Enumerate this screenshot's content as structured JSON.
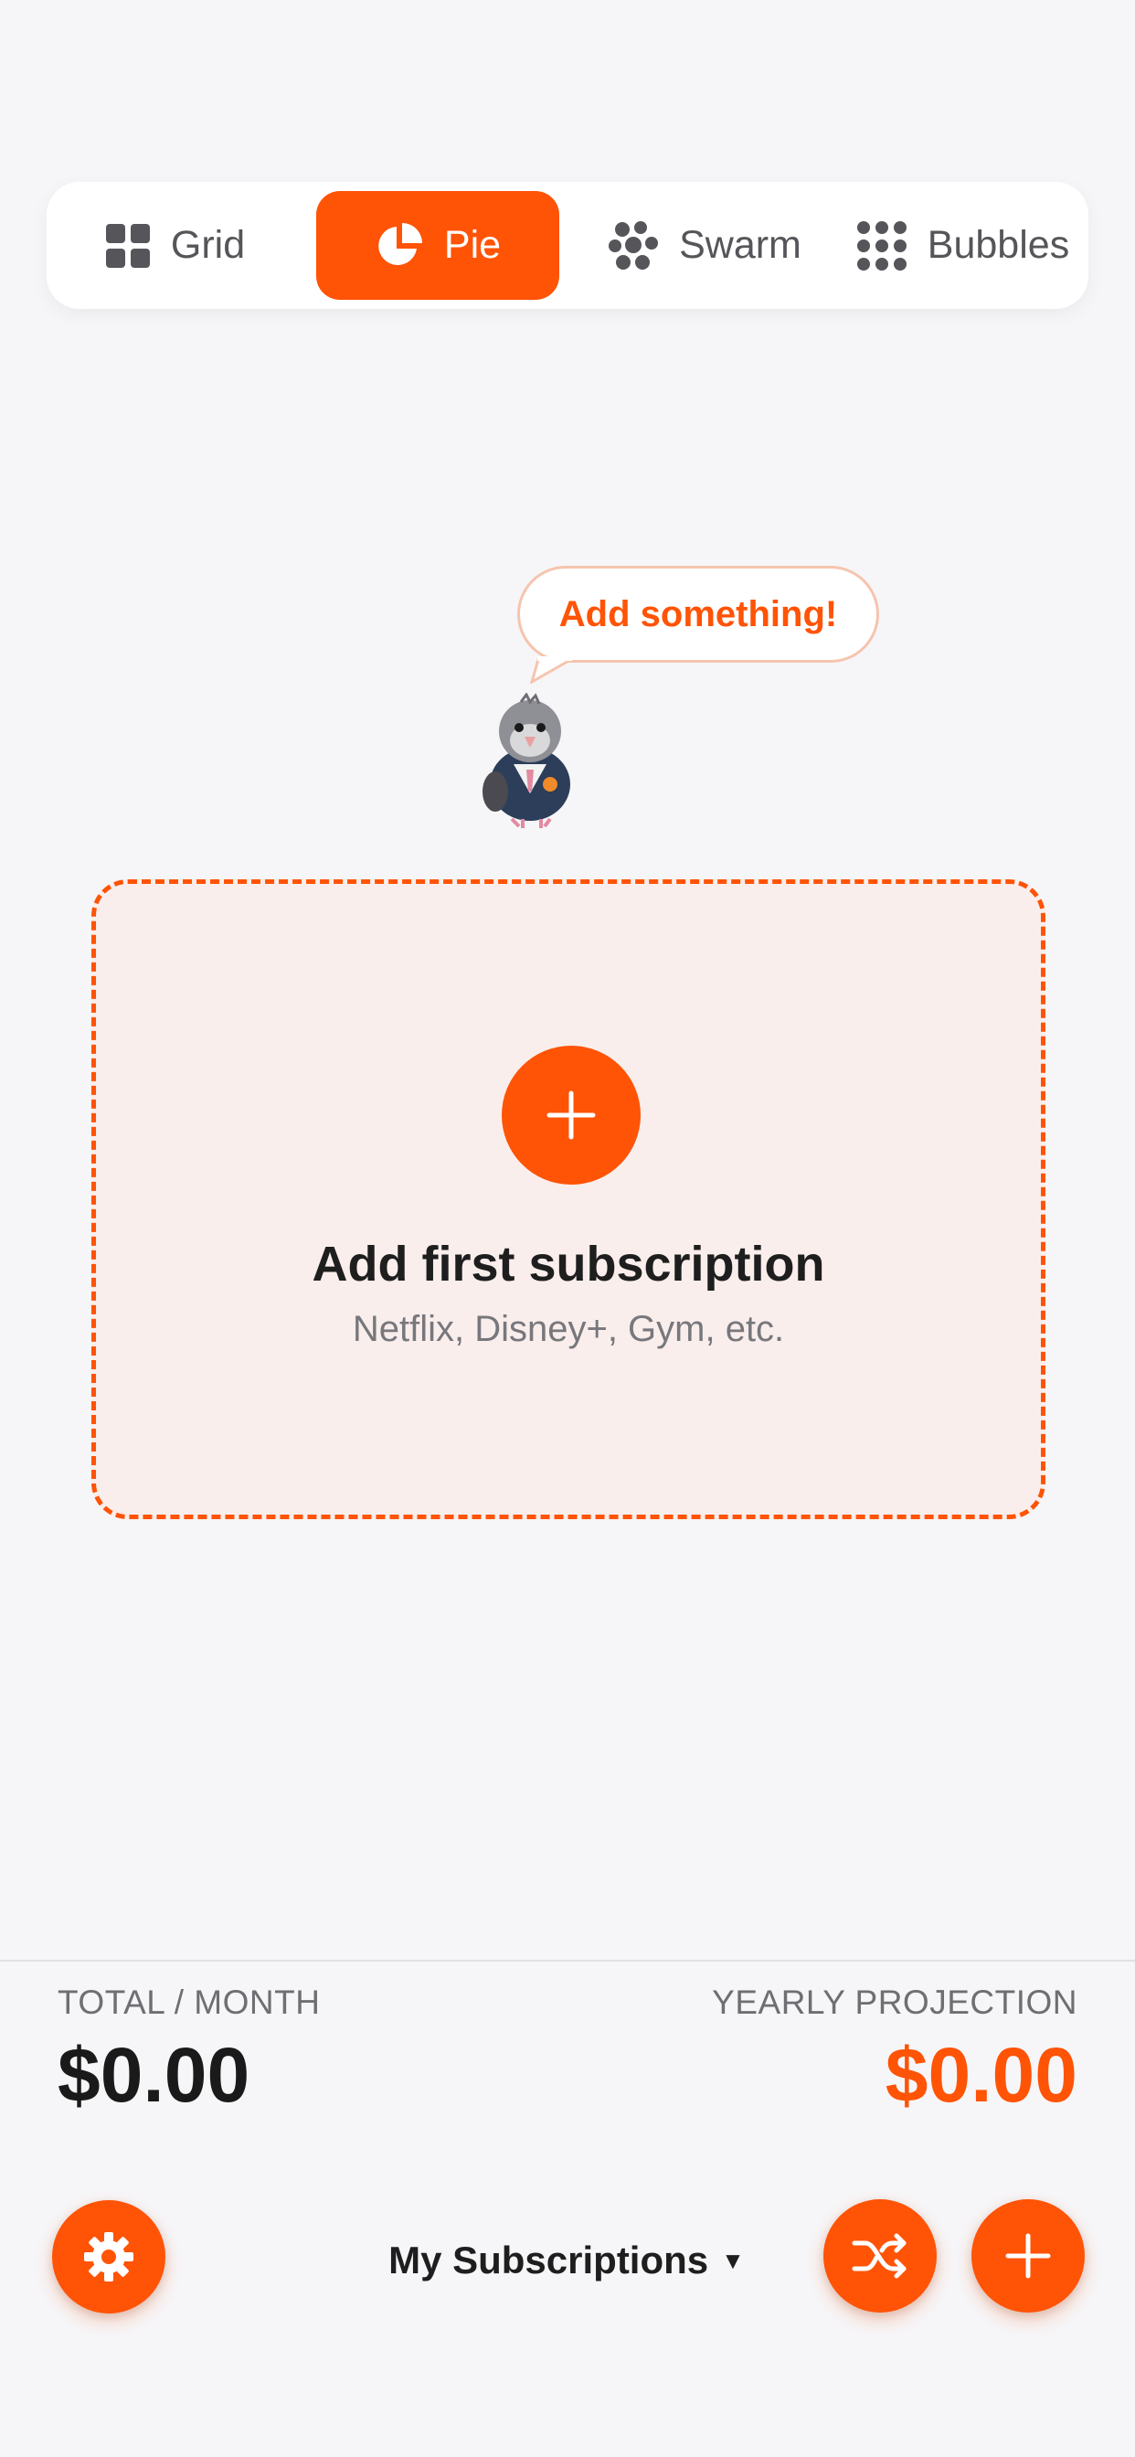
{
  "view_switcher": {
    "tabs": [
      {
        "label": "Grid",
        "icon": "grid-icon",
        "active": false
      },
      {
        "label": "Pie",
        "icon": "pie-chart-icon",
        "active": true
      },
      {
        "label": "Swarm",
        "icon": "swarm-icon",
        "active": false
      },
      {
        "label": "Bubbles",
        "icon": "bubbles-icon",
        "active": false
      }
    ]
  },
  "mascot": {
    "speech": "Add something!",
    "icon": "pigeon-mascot-icon"
  },
  "empty_state": {
    "title": "Add first subscription",
    "subtitle": "Netflix, Disney+, Gym, etc.",
    "icon": "plus-icon"
  },
  "summary": {
    "monthly_label": "TOTAL / MONTH",
    "monthly_value": "$0.00",
    "yearly_label": "YEARLY PROJECTION",
    "yearly_value": "$0.00"
  },
  "bottom_bar": {
    "list_name": "My Subscriptions",
    "caret": "▼",
    "settings_icon": "gear-icon",
    "shuffle_icon": "shuffle-icon",
    "add_icon": "plus-icon"
  },
  "colors": {
    "accent": "#ff5306",
    "background": "#f6f6f8",
    "card_fill": "#f9eeec",
    "text_dark": "#1e1e1e",
    "text_muted": "#6e6e73"
  }
}
